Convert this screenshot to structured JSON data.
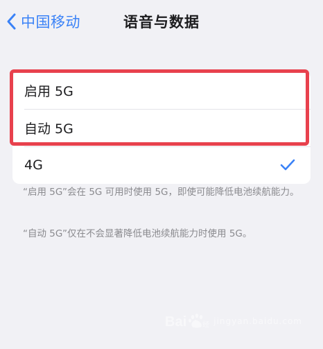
{
  "nav": {
    "back_label": "中国移动",
    "title": "语音与数据"
  },
  "options": [
    {
      "label": "启用 5G",
      "selected": false
    },
    {
      "label": "自动 5G",
      "selected": false
    },
    {
      "label": "4G",
      "selected": true
    }
  ],
  "notes": {
    "line1": "“启用 5G”会在 5G 可用时使用 5G，即使可能降低电池续航能力。",
    "line2": "“自动 5G”仅在不会显著降低电池续航能力时使用 5G。"
  },
  "watermark": {
    "sub_text": "jingyan.baidu.com"
  },
  "colors": {
    "accent": "#3a82f7",
    "highlight": "#e8414d",
    "background": "#f1f1f5"
  },
  "icons": {
    "back": "chevron-left-icon",
    "selected": "checkmark-icon"
  }
}
